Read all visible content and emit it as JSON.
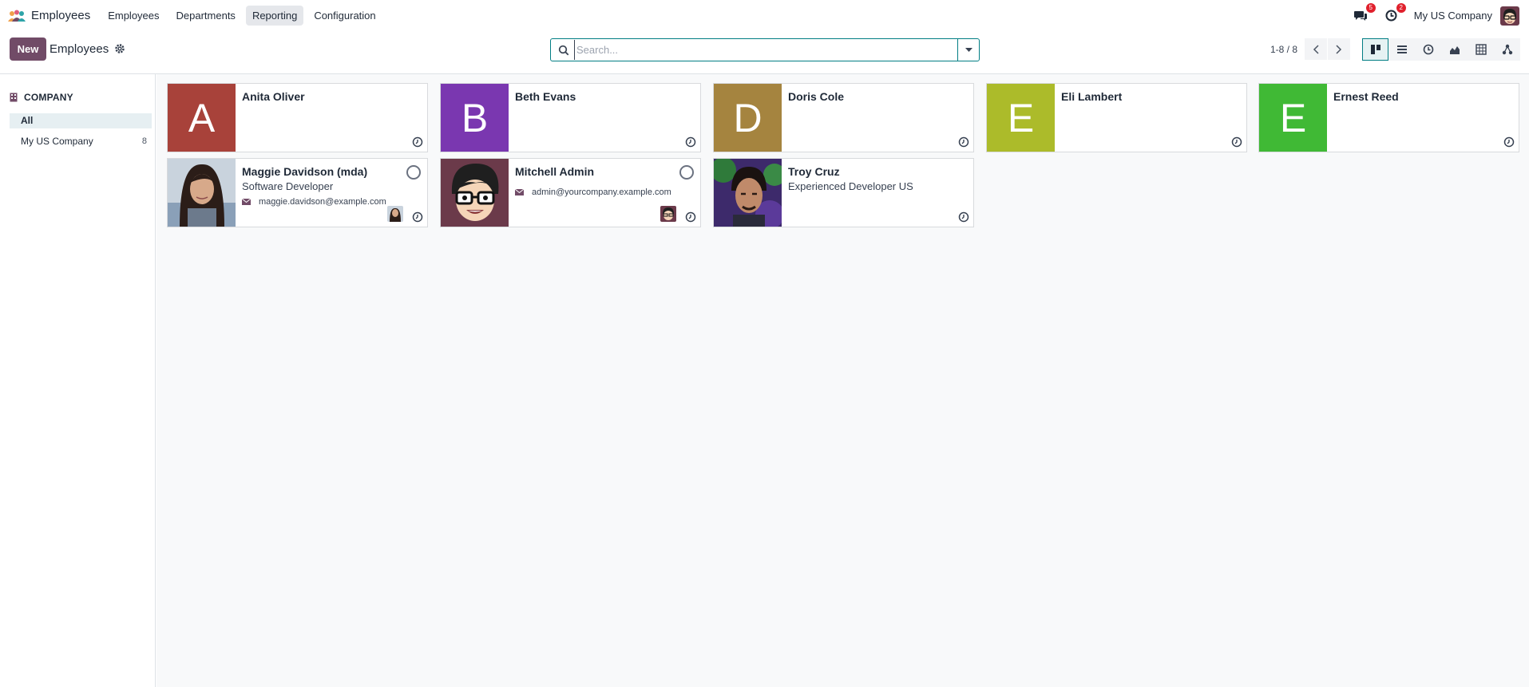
{
  "navbar": {
    "app_name": "Employees",
    "menu": [
      "Employees",
      "Departments",
      "Reporting",
      "Configuration"
    ],
    "active_menu": "Reporting",
    "messages_count": "5",
    "activities_count": "2",
    "company": "My US Company"
  },
  "control_panel": {
    "new_label": "New",
    "title": "Employees",
    "search_placeholder": "Search...",
    "pager": "1-8 / 8",
    "views": [
      "kanban-view",
      "list-view",
      "activity-view",
      "graph-view",
      "pivot-view",
      "hierarchy-view"
    ],
    "active_view": "kanban-view"
  },
  "sidebar": {
    "header": "COMPANY",
    "items": [
      {
        "label": "All",
        "count": ""
      },
      {
        "label": "My US Company",
        "count": "8"
      }
    ]
  },
  "employees": [
    {
      "name": "Anita Oliver",
      "initial": "A",
      "color": "#a8423a",
      "job": "",
      "email": ""
    },
    {
      "name": "Beth Evans",
      "initial": "B",
      "color": "#7a37b0",
      "job": "",
      "email": ""
    },
    {
      "name": "Doris Cole",
      "initial": "D",
      "color": "#a5843f",
      "job": "",
      "email": ""
    },
    {
      "name": "Eli Lambert",
      "initial": "E",
      "color": "#acbb2a",
      "job": "",
      "email": ""
    },
    {
      "name": "Ernest Reed",
      "initial": "E",
      "color": "#40b935",
      "job": "",
      "email": ""
    },
    {
      "name": "Maggie Davidson (mda)",
      "initial": "",
      "color": "",
      "job": "Software Developer",
      "email": "maggie.davidson@example.com"
    },
    {
      "name": "Mitchell Admin",
      "initial": "",
      "color": "",
      "job": "",
      "email": "admin@yourcompany.example.com"
    },
    {
      "name": "Troy Cruz",
      "initial": "",
      "color": "",
      "job": "Experienced Developer US",
      "email": ""
    }
  ],
  "colors": {
    "brand": "#714b67",
    "accent": "#017e84",
    "badge": "#e0202c"
  }
}
